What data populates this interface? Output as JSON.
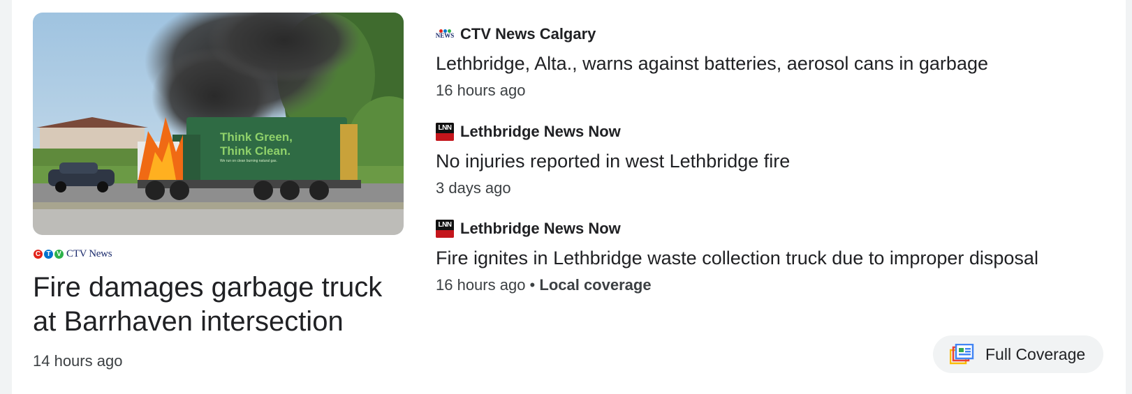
{
  "lead": {
    "source_logo_text": "CTV News",
    "title": "Fire damages garbage truck at Barrhaven intersection",
    "time": "14 hours ago",
    "truck_text_line1": "Think Green,",
    "truck_text_line2": "Think Clean.",
    "truck_text_small": "We run on clean burning natural gas."
  },
  "stories": [
    {
      "source": "CTV News Calgary",
      "icon": "ctv-news-icon",
      "headline": "Lethbridge, Alta., warns against batteries, aerosol cans in garbage",
      "time": "16 hours ago",
      "tag": ""
    },
    {
      "source": "Lethbridge News Now",
      "icon": "lnn-icon",
      "headline": "No injuries reported in west Lethbridge fire",
      "time": "3 days ago",
      "tag": ""
    },
    {
      "source": "Lethbridge News Now",
      "icon": "lnn-icon",
      "headline": "Fire ignites in Lethbridge waste collection truck due to improper disposal",
      "time": "16 hours ago",
      "separator": " • ",
      "tag": "Local coverage"
    }
  ],
  "full_coverage": {
    "label": "Full Coverage"
  },
  "icons": {
    "lnn_text": "LNN",
    "ctv_mini_word": "NEWS"
  },
  "colors": {
    "ctv_red": "#e2231a",
    "ctv_blue": "#0072ce",
    "ctv_green": "#2db24a",
    "lnn_red": "#c4161c"
  }
}
